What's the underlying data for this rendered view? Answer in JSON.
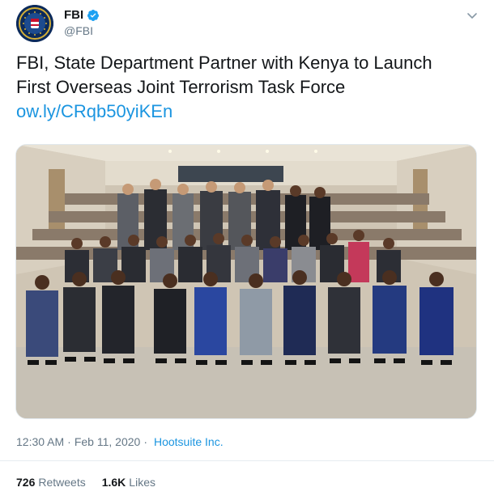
{
  "account": {
    "display_name": "FBI",
    "handle": "@FBI",
    "verified": true,
    "avatar_icon": "fbi-seal-icon"
  },
  "tweet": {
    "line1": "FBI, State Department Partner with Kenya to Launch",
    "line2": "First Overseas Joint Terrorism Task Force",
    "link": "ow.ly/CRqb50yiKEn"
  },
  "meta": {
    "time": "12:30 AM",
    "separator": "·",
    "date": "Feb 11, 2020",
    "source": "Hootsuite Inc."
  },
  "stats": {
    "retweets_count": "726",
    "retweets_label": "Retweets",
    "likes_count": "1.6K",
    "likes_label": "Likes"
  },
  "colors": {
    "link": "#1b95e0",
    "verified_badge": "#1da1f2",
    "secondary_text": "#657786"
  }
}
